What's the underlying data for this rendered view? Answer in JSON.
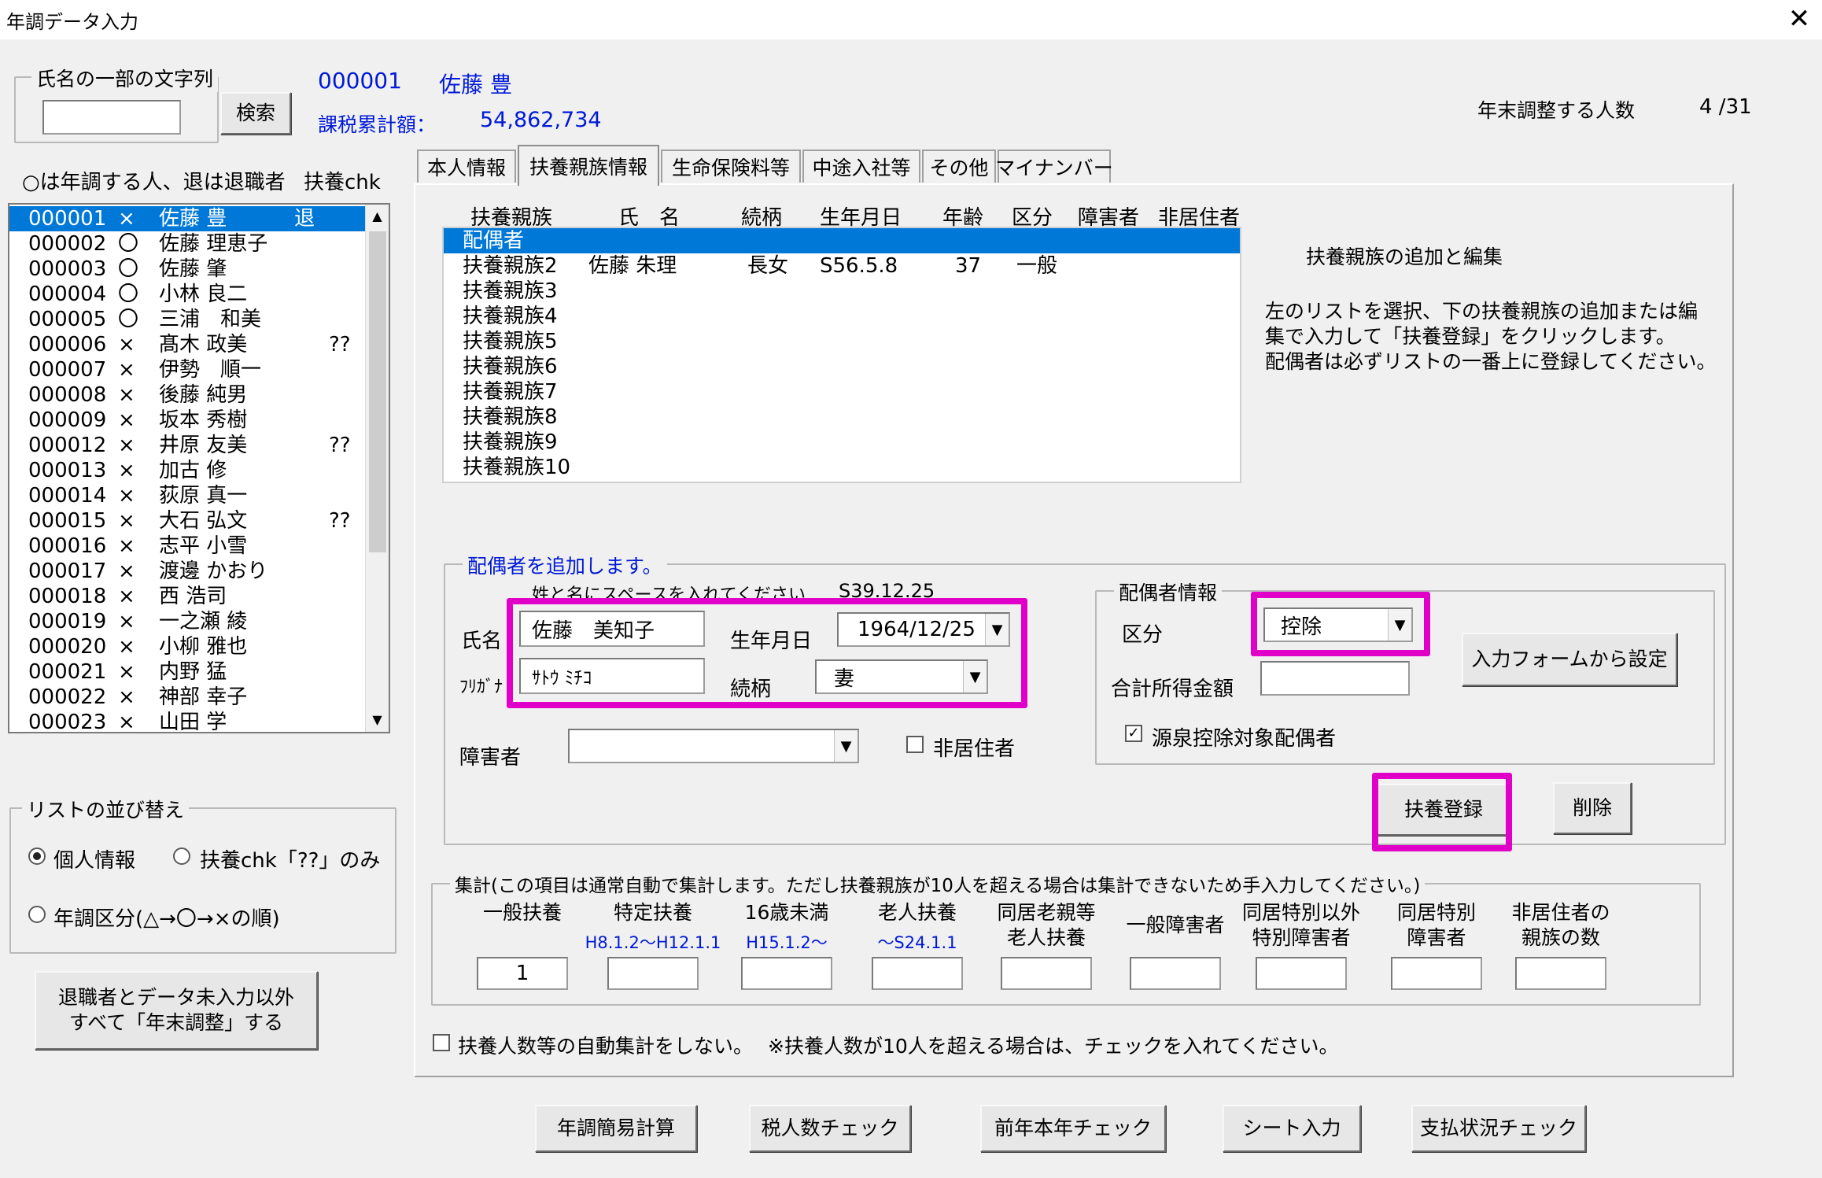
{
  "window": {
    "title": "年調データ入力",
    "close": "✕"
  },
  "search": {
    "group_label": "氏名の一部の文字列",
    "button": "検索",
    "value": ""
  },
  "header": {
    "id": "000001",
    "name": "佐藤 豊",
    "tax_label": "課税累計額：",
    "tax_value": "54,862,734",
    "count_label": "年末調整する人数",
    "count_value": "4 /31"
  },
  "list": {
    "legend": "○は年調する人、退は退職者",
    "chk_header": "扶養chk",
    "rows": [
      {
        "id": "000001",
        "mark": "×",
        "name": "佐藤 豊",
        "retired": "退",
        "chk": ""
      },
      {
        "id": "000002",
        "mark": "〇",
        "name": "佐藤 理恵子",
        "retired": "",
        "chk": ""
      },
      {
        "id": "000003",
        "mark": "〇",
        "name": "佐藤 肇",
        "retired": "",
        "chk": ""
      },
      {
        "id": "000004",
        "mark": "〇",
        "name": "小林 良二",
        "retired": "",
        "chk": ""
      },
      {
        "id": "000005",
        "mark": "〇",
        "name": "三浦　和美",
        "retired": "",
        "chk": ""
      },
      {
        "id": "000006",
        "mark": "×",
        "name": "髙木 政美",
        "retired": "",
        "chk": "??"
      },
      {
        "id": "000007",
        "mark": "×",
        "name": "伊勢　順一",
        "retired": "",
        "chk": ""
      },
      {
        "id": "000008",
        "mark": "×",
        "name": "後藤 純男",
        "retired": "",
        "chk": ""
      },
      {
        "id": "000009",
        "mark": "×",
        "name": "坂本 秀樹",
        "retired": "",
        "chk": ""
      },
      {
        "id": "000012",
        "mark": "×",
        "name": "井原 友美",
        "retired": "",
        "chk": "??"
      },
      {
        "id": "000013",
        "mark": "×",
        "name": "加古 修",
        "retired": "",
        "chk": ""
      },
      {
        "id": "000014",
        "mark": "×",
        "name": "荻原 真一",
        "retired": "",
        "chk": ""
      },
      {
        "id": "000015",
        "mark": "×",
        "name": "大石 弘文",
        "retired": "",
        "chk": "??"
      },
      {
        "id": "000016",
        "mark": "×",
        "name": "志平 小雪",
        "retired": "",
        "chk": ""
      },
      {
        "id": "000017",
        "mark": "×",
        "name": "渡邊 かおり",
        "retired": "",
        "chk": ""
      },
      {
        "id": "000018",
        "mark": "×",
        "name": "西 浩司",
        "retired": "",
        "chk": ""
      },
      {
        "id": "000019",
        "mark": "×",
        "name": "一之瀬 綾",
        "retired": "",
        "chk": ""
      },
      {
        "id": "000020",
        "mark": "×",
        "name": "小柳 雅也",
        "retired": "",
        "chk": ""
      },
      {
        "id": "000021",
        "mark": "×",
        "name": "内野 猛",
        "retired": "",
        "chk": ""
      },
      {
        "id": "000022",
        "mark": "×",
        "name": "神部 幸子",
        "retired": "",
        "chk": ""
      },
      {
        "id": "000023",
        "mark": "×",
        "name": "山田 学",
        "retired": "",
        "chk": ""
      }
    ]
  },
  "sort": {
    "legend": "リストの並び替え",
    "opt1": "個人情報",
    "opt2": "扶養chk「??」のみ",
    "opt3": "年調区分(△→〇→×の順)"
  },
  "bulk_button": {
    "line1": "退職者とデータ未入力以外",
    "line2": "すべて「年末調整」する"
  },
  "tabs": [
    "本人情報",
    "扶養親族情報",
    "生命保険料等",
    "中途入社等",
    "その他",
    "マイナンバー"
  ],
  "dep_list": {
    "headers": [
      "扶養親族",
      "氏　名",
      "続柄",
      "生年月日",
      "年齢",
      "区分",
      "障害者",
      "非居住者"
    ],
    "rows": [
      {
        "label": "配偶者",
        "name": "",
        "rel": "",
        "birth": "",
        "age": "",
        "kubun": ""
      },
      {
        "label": "扶養親族2",
        "name": "佐藤 朱理",
        "rel": "長女",
        "birth": "S56.5.8",
        "age": "37",
        "kubun": "一般"
      },
      {
        "label": "扶養親族3",
        "name": "",
        "rel": "",
        "birth": "",
        "age": "",
        "kubun": ""
      },
      {
        "label": "扶養親族4",
        "name": "",
        "rel": "",
        "birth": "",
        "age": "",
        "kubun": ""
      },
      {
        "label": "扶養親族5",
        "name": "",
        "rel": "",
        "birth": "",
        "age": "",
        "kubun": ""
      },
      {
        "label": "扶養親族6",
        "name": "",
        "rel": "",
        "birth": "",
        "age": "",
        "kubun": ""
      },
      {
        "label": "扶養親族7",
        "name": "",
        "rel": "",
        "birth": "",
        "age": "",
        "kubun": ""
      },
      {
        "label": "扶養親族8",
        "name": "",
        "rel": "",
        "birth": "",
        "age": "",
        "kubun": ""
      },
      {
        "label": "扶養親族9",
        "name": "",
        "rel": "",
        "birth": "",
        "age": "",
        "kubun": ""
      },
      {
        "label": "扶養親族10",
        "name": "",
        "rel": "",
        "birth": "",
        "age": "",
        "kubun": ""
      }
    ]
  },
  "help": {
    "title": "扶養親族の追加と編集",
    "line1": "左のリストを選択、下の扶養親族の追加または編",
    "line2": "集で入力して「扶養登録」をクリックします。",
    "line3": "配偶者は必ずリストの一番上に登録してください。"
  },
  "edit": {
    "legend": "配偶者を追加します。",
    "hint": "姓と名にスペースを入れてください",
    "wareki": "S39.12.25",
    "name_label": "氏名",
    "name_value": "佐藤　美知子",
    "kana_label": "ﾌﾘｶﾞﾅ",
    "kana_value": "ｻﾄｳ ﾐﾁｺ",
    "birth_label": "生年月日",
    "birth_value": "1964/12/25",
    "rel_label": "続柄",
    "rel_value": "妻",
    "shogai_label": "障害者",
    "shogai_value": "",
    "nonres_label": "非居住者",
    "spouse": {
      "legend": "配偶者情報",
      "kubun_label": "区分",
      "kubun_value": "控除",
      "income_label": "合計所得金額",
      "income_value": "",
      "gensen_label": "源泉控除対象配偶者"
    },
    "from_form_button": "入力フォームから設定",
    "register_button": "扶養登録",
    "delete_button": "削除"
  },
  "totals": {
    "legend": "集計(この項目は通常自動で集計します。ただし扶養親族が10人を超える場合は集計できないため手入力してください。)",
    "cols": [
      {
        "h1": "一般扶養",
        "h2": "",
        "sub": "",
        "value": "1"
      },
      {
        "h1": "特定扶養",
        "h2": "",
        "sub": "H8.1.2～H12.1.1",
        "value": ""
      },
      {
        "h1": "16歳未満",
        "h2": "",
        "sub": "H15.1.2～",
        "value": ""
      },
      {
        "h1": "老人扶養",
        "h2": "",
        "sub": "～S24.1.1",
        "value": ""
      },
      {
        "h1": "同居老親等",
        "h2": "老人扶養",
        "sub": "",
        "value": ""
      },
      {
        "h1": "一般障害者",
        "h2": "",
        "sub": "",
        "value": ""
      },
      {
        "h1": "同居特別以外",
        "h2": "特別障害者",
        "sub": "",
        "value": ""
      },
      {
        "h1": "同居特別",
        "h2": "障害者",
        "sub": "",
        "value": ""
      },
      {
        "h1": "非居住者の",
        "h2": "親族の数",
        "sub": "",
        "value": ""
      }
    ]
  },
  "auto_check": {
    "label": "扶養人数等の自動集計をしない。",
    "note": "※扶養人数が10人を超える場合は、チェックを入れてください。"
  },
  "bottom_buttons": [
    "年調簡易計算",
    "税人数チェック",
    "前年本年チェック",
    "シート入力",
    "支払状況チェック"
  ],
  "colors": {
    "selection": "#0078d7",
    "highlight": "#e100c8",
    "accent_text": "#0019d6"
  }
}
